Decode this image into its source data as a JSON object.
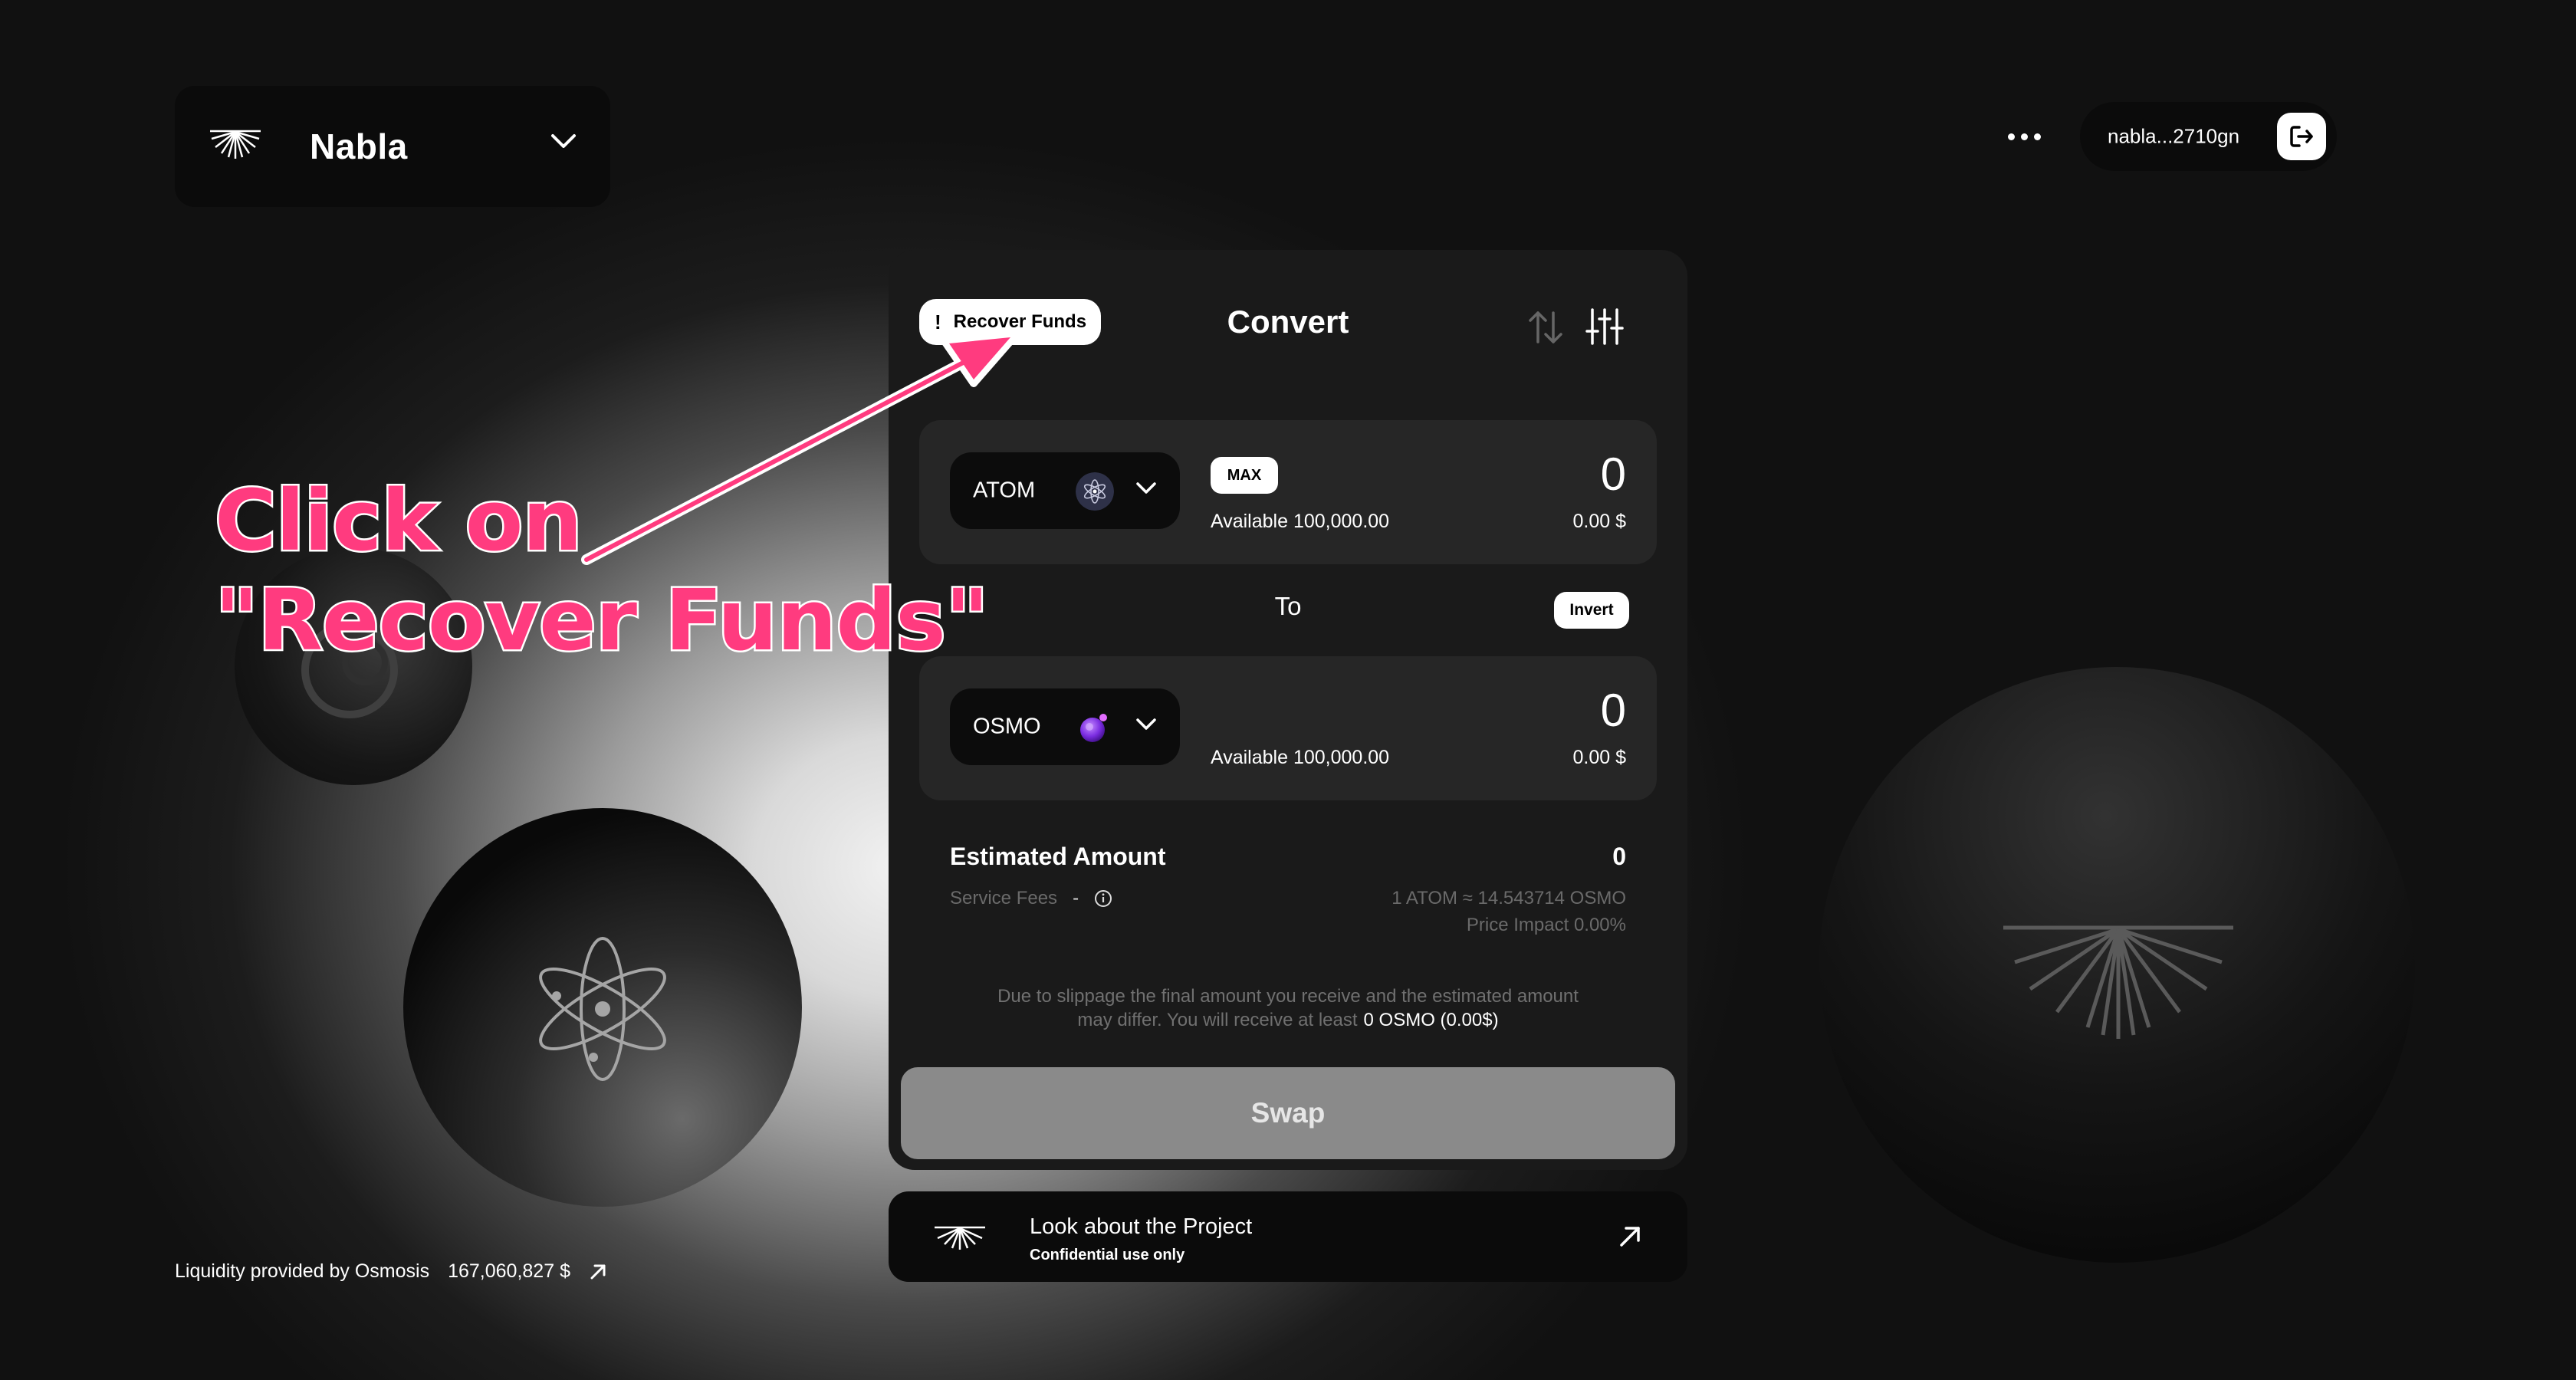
{
  "header": {
    "project_name": "Nabla",
    "wallet_address": "nabla...2710gn",
    "more_icon": "more-dots-icon",
    "logout_icon": "logout-icon"
  },
  "card": {
    "recover_label": "Recover Funds",
    "title": "Convert",
    "from": {
      "symbol": "ATOM",
      "max_label": "MAX",
      "available": "Available 100,000.00",
      "amount": "0",
      "usd": "0.00 $"
    },
    "to_label": "To",
    "invert_label": "Invert",
    "to": {
      "symbol": "OSMO",
      "available": "Available 100,000.00",
      "amount": "0",
      "usd": "0.00 $"
    },
    "estimated_label": "Estimated Amount",
    "estimated_value": "0",
    "service_fees_label": "Service Fees",
    "service_fees_value": "-",
    "rate": "1 ATOM ≈ 14.543714 OSMO",
    "price_impact": "Price Impact 0.00%",
    "slippage_note": "Due to slippage the final amount you receive and the estimated amount may differ. You will receive at least",
    "min_receive": "0 OSMO (0.00$)",
    "swap_label": "Swap"
  },
  "project_link": {
    "title": "Look about the Project",
    "subtitle": "Confidential use only"
  },
  "footer": {
    "liquidity_label": "Liquidity provided by Osmosis",
    "liquidity_value": "167,060,827 $"
  },
  "annotation": {
    "line1": "Click on",
    "line2": "\"Recover Funds\"",
    "color": "#ff3b7f"
  },
  "colors": {
    "card_bg": "#1a1a1a",
    "panel_bg": "#262626",
    "swap_disabled": "#8a8a8a"
  }
}
